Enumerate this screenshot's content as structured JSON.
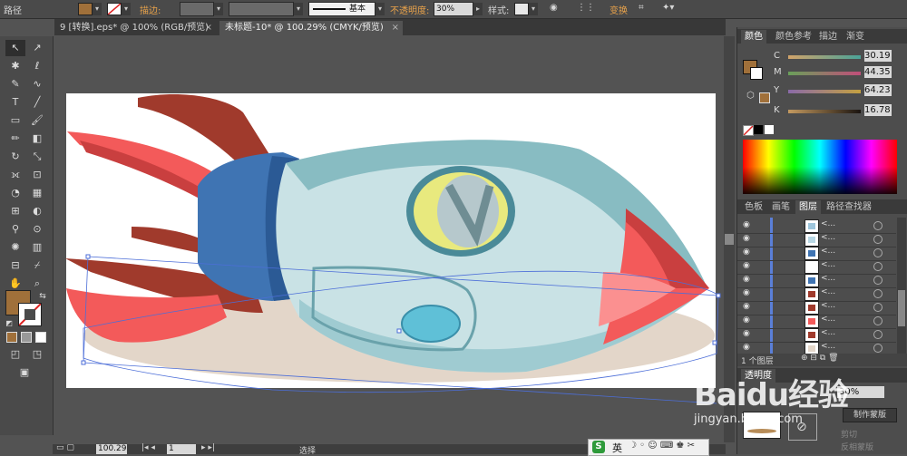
{
  "control_bar": {
    "object_type": "路径",
    "stroke_label": "描边:",
    "stroke_style": "基本",
    "opacity_label": "不透明度:",
    "opacity_value": "30%",
    "style_label": "样式:",
    "transform_label": "变换",
    "fill_color": "#a0703a"
  },
  "tabs": [
    {
      "label": "9 [转换].eps* @ 100% (RGB/预览)",
      "close": "×"
    },
    {
      "label": "未标题-10* @ 100.29% (CMYK/预览)",
      "close": "×"
    }
  ],
  "color_panel": {
    "tabs": [
      "颜色",
      "颜色参考",
      "描边",
      "渐变"
    ],
    "channels": [
      {
        "label": "C",
        "value": "30.19",
        "pos": 0.3
      },
      {
        "label": "M",
        "value": "44.35",
        "pos": 0.44
      },
      {
        "label": "Y",
        "value": "64.23",
        "pos": 0.64
      },
      {
        "label": "K",
        "value": "16.78",
        "pos": 0.17
      }
    ],
    "fill_color": "#a0703a"
  },
  "layers_panel": {
    "tabs": [
      "色板",
      "画笔",
      "图层",
      "路径查找器"
    ],
    "rows": [
      "<...",
      "<...",
      "<...",
      "<...",
      "<...",
      "<...",
      "<...",
      "<...",
      "<...",
      "<..."
    ],
    "footer": "1 个图层"
  },
  "transparency_panel": {
    "title": "透明度",
    "opacity": "30%",
    "make_mask": "制作蒙版",
    "clip": "剪切",
    "invert_mask": "反相蒙版"
  },
  "status_bar": {
    "zoom": "100.29",
    "page": "1",
    "tool": "选择"
  },
  "watermark": {
    "brand": "Baidu经验",
    "url": "jingyan.baidu.com"
  },
  "ime": {
    "lang": "英"
  }
}
